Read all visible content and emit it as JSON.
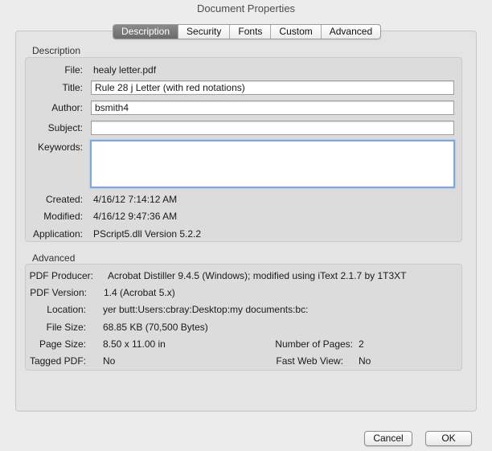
{
  "window": {
    "title": "Document Properties"
  },
  "tabs": [
    {
      "label": "Description"
    },
    {
      "label": "Security"
    },
    {
      "label": "Fonts"
    },
    {
      "label": "Custom"
    },
    {
      "label": "Advanced"
    }
  ],
  "description": {
    "heading": "Description",
    "file_label": "File:",
    "file_value": "healy letter.pdf",
    "title_label": "Title:",
    "title_value": "Rule 28 j Letter (with red notations)",
    "author_label": "Author:",
    "author_value": "bsmith4",
    "subject_label": "Subject:",
    "subject_value": "",
    "keywords_label": "Keywords:",
    "keywords_value": "",
    "created_label": "Created:",
    "created_value": "4/16/12 7:14:12 AM",
    "modified_label": "Modified:",
    "modified_value": "4/16/12 9:47:36 AM",
    "application_label": "Application:",
    "application_value": "PScript5.dll Version 5.2.2"
  },
  "advanced": {
    "heading": "Advanced",
    "producer_label": "PDF Producer:",
    "producer_value": "Acrobat Distiller 9.4.5 (Windows); modified using iText 2.1.7 by 1T3XT",
    "version_label": "PDF Version:",
    "version_value": "1.4 (Acrobat 5.x)",
    "location_label": "Location:",
    "location_value": "yer butt:Users:cbray:Desktop:my documents:bc:",
    "filesize_label": "File Size:",
    "filesize_value": "68.85 KB (70,500 Bytes)",
    "pagesize_label": "Page Size:",
    "pagesize_value": "8.50 x 11.00 in",
    "pages_label": "Number of Pages:",
    "pages_value": "2",
    "tagged_label": "Tagged PDF:",
    "tagged_value": "No",
    "fastweb_label": "Fast Web View:",
    "fastweb_value": "No"
  },
  "buttons": {
    "cancel": "Cancel",
    "ok": "OK"
  }
}
